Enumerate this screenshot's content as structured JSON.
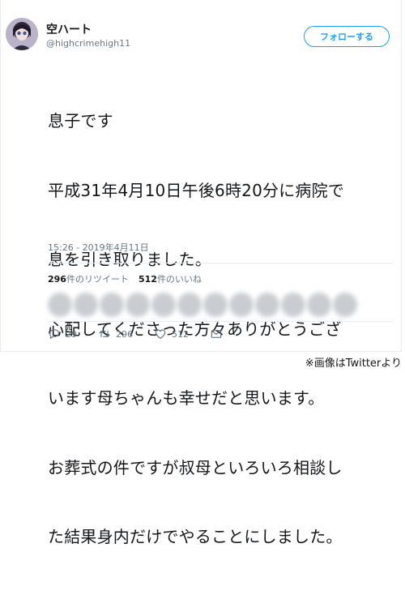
{
  "user": {
    "name": "空ハート",
    "handle": "@highcrimehigh11"
  },
  "follow_label": "フォローする",
  "tweet": {
    "lines": [
      "息子です",
      "平成31年4月10日午後6時20分に病院で",
      "息を引き取りました。",
      "心配してくださった方々ありがとうござ",
      "います母ちゃんも幸せだと思います。",
      "お葬式の件ですが叔母といろいろ相談し",
      "た結果身内だけでやることにしました。"
    ],
    "timestamp": "15:26 - 2019年4月11日"
  },
  "stats": {
    "retweets_count": "296",
    "retweets_label": "件のリツイート",
    "likes_count": "512",
    "likes_label": "件のいいね"
  },
  "actions": {
    "reply_count": "29",
    "retweet_count": "296",
    "like_count": "512"
  },
  "icons": {
    "reply": "reply-icon",
    "retweet": "retweet-icon",
    "like": "heart-icon",
    "dm": "envelope-icon"
  },
  "colors": {
    "accent": "#1da1f2",
    "muted": "#657786",
    "text": "#14171a",
    "border": "#e6ecf0"
  },
  "credit": "※画像はTwitterより"
}
